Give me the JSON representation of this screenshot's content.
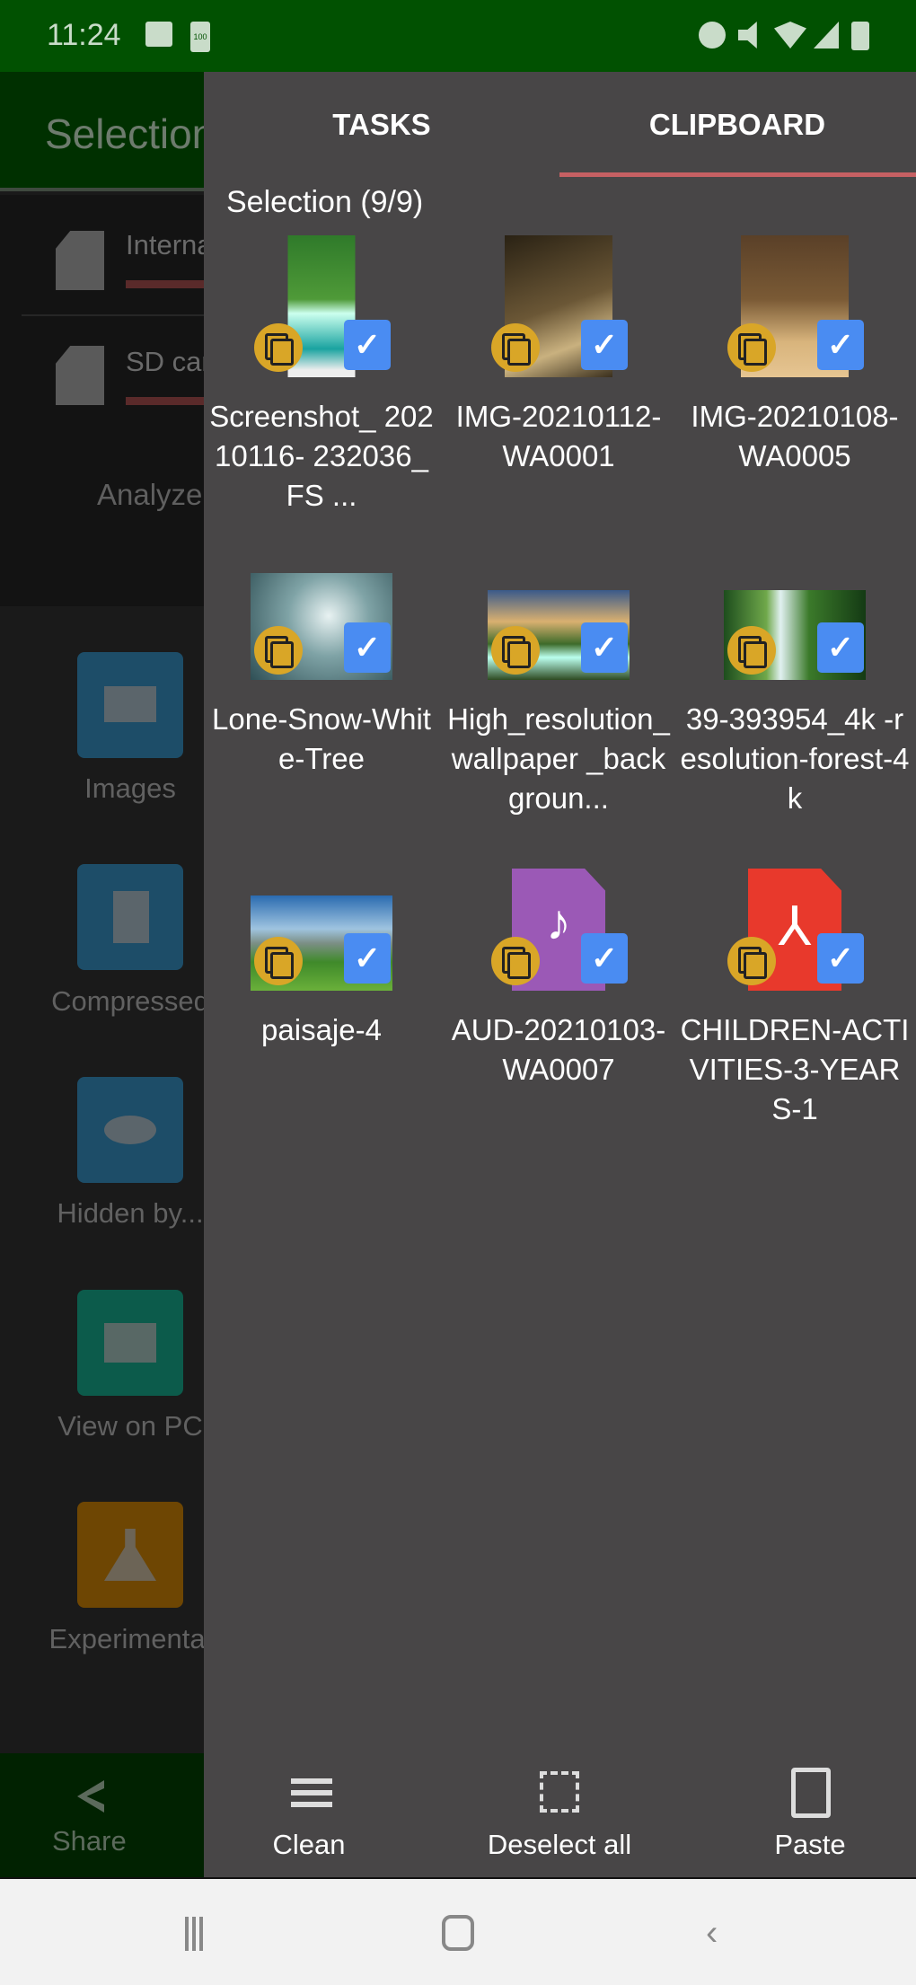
{
  "status": {
    "time": "11:24",
    "battery_badge": "100",
    "icons": [
      "gallery-icon",
      "battery-saver-icon",
      "alarm-icon",
      "mute-icon",
      "wifi-icon",
      "signal-icon",
      "battery-icon"
    ]
  },
  "background": {
    "title": "Selection",
    "storage": [
      {
        "label": "Internal"
      },
      {
        "label": "SD card"
      }
    ],
    "analyze": "Analyze",
    "tools": [
      {
        "label": "Images",
        "color": "#1d4d68"
      },
      {
        "label": "Compressed",
        "color": "#1d4d68"
      },
      {
        "label": "Hidden by...",
        "color": "#1d4d68"
      },
      {
        "label": "View on PC",
        "color": "#0c5b4b"
      },
      {
        "label": "Experimental",
        "color": "#6e4603"
      }
    ],
    "share": "Share"
  },
  "drawer": {
    "tabs": [
      {
        "label": "TASKS"
      },
      {
        "label": "CLIPBOARD",
        "active": true
      }
    ],
    "selection": "Selection (9/9)",
    "items": [
      {
        "name": "Screenshot_ 20210116- 232036_FS ...",
        "type": "image"
      },
      {
        "name": "IMG-20210112-WA0001",
        "type": "image"
      },
      {
        "name": "IMG-20210108-WA0005",
        "type": "image"
      },
      {
        "name": "Lone-Snow-White-Tree",
        "type": "image"
      },
      {
        "name": "High_resolution_wallpaper _backgroun...",
        "type": "image"
      },
      {
        "name": "39-393954_4k -resolution-forest-4k",
        "type": "image"
      },
      {
        "name": "paisaje-4",
        "type": "image"
      },
      {
        "name": "AUD-20210103-WA0007",
        "type": "audio"
      },
      {
        "name": "CHILDREN-ACTIVITIES-3-YEARS-1",
        "type": "pdf"
      }
    ],
    "actions": [
      {
        "label": "Clean"
      },
      {
        "label": "Deselect all"
      },
      {
        "label": "Paste"
      }
    ],
    "accent": "#c66063",
    "check_color": "#4a8cf2",
    "copy_color": "#d9a627"
  }
}
